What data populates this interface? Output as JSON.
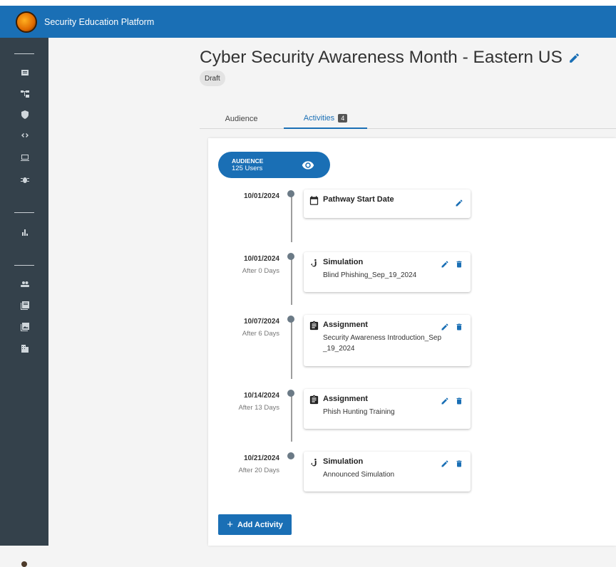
{
  "app": {
    "title": "Security Education Platform"
  },
  "page": {
    "title": "Cyber Security Awareness Month - Eastern US",
    "status": "Draft"
  },
  "tabs": [
    {
      "label": "Audience"
    },
    {
      "label": "Activities",
      "badge": "4"
    }
  ],
  "audience": {
    "label": "AUDIENCE",
    "users": "125 Users"
  },
  "timeline": [
    {
      "date": "10/01/2024",
      "after": "",
      "type": "Pathway Start Date",
      "name": "",
      "icon": "calendar-icon"
    },
    {
      "date": "10/01/2024",
      "after": "After 0 Days",
      "type": "Simulation",
      "name": "Blind Phishing_Sep_19_2024",
      "icon": "hook-icon"
    },
    {
      "date": "10/07/2024",
      "after": "After 6 Days",
      "type": "Assignment",
      "name": "Security Awareness Introduction_Sep_19_2024",
      "icon": "clipboard-icon"
    },
    {
      "date": "10/14/2024",
      "after": "After 13 Days",
      "type": "Assignment",
      "name": "Phish Hunting Training",
      "icon": "clipboard-icon"
    },
    {
      "date": "10/21/2024",
      "after": "After 20 Days",
      "type": "Simulation",
      "name": "Announced Simulation",
      "icon": "hook-icon"
    }
  ],
  "add_activity": {
    "label": "Add Activity",
    "icon": "plus-icon"
  },
  "colors": {
    "brand": "#1a6fb5",
    "sidebar": "#34414b"
  }
}
